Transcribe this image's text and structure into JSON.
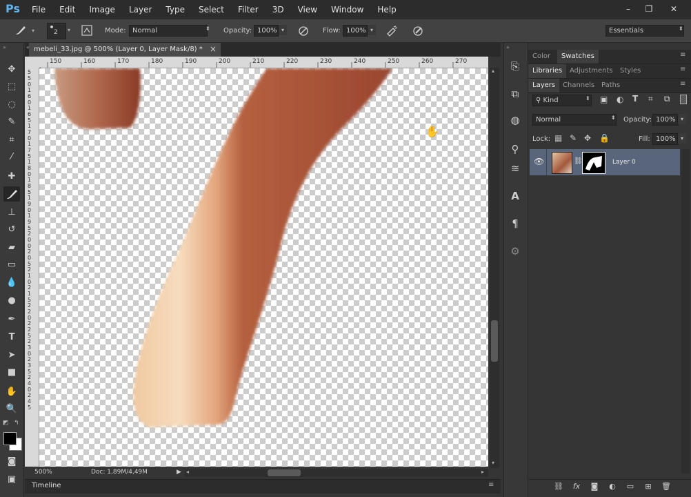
{
  "app": {
    "logo": "Ps",
    "menu": [
      "File",
      "Edit",
      "Image",
      "Layer",
      "Type",
      "Select",
      "Filter",
      "3D",
      "View",
      "Window",
      "Help"
    ],
    "window_controls": [
      "–",
      "❐",
      "✕"
    ]
  },
  "options_bar": {
    "brush_size": "2",
    "mode_label": "Mode:",
    "mode_value": "Normal",
    "opacity_label": "Opacity:",
    "opacity_value": "100%",
    "flow_label": "Flow:",
    "flow_value": "100%",
    "workspace": "Essentials"
  },
  "document": {
    "tab_title": "mebeli_33.jpg @ 500% (Layer 0, Layer Mask/8) *",
    "close": "×",
    "ruler_top": [
      "150",
      "160",
      "170",
      "180",
      "190",
      "200",
      "210",
      "220",
      "230",
      "240",
      "250",
      "260",
      "270"
    ],
    "ruler_left": [
      "5",
      "5",
      "0",
      "1",
      "6",
      "0",
      "1",
      "6",
      "5",
      "1",
      "7",
      "0",
      "1",
      "7",
      "5",
      "1",
      "8",
      "0",
      "1",
      "8",
      "5",
      "1",
      "9",
      "0",
      "1",
      "9",
      "5",
      "2",
      "0",
      "0",
      "2",
      "0",
      "5",
      "2",
      "1",
      "0",
      "2",
      "1",
      "5",
      "2",
      "2",
      "0",
      "2",
      "2",
      "5",
      "2",
      "3",
      "0",
      "2",
      "3",
      "5",
      "2",
      "4",
      "0",
      "2",
      "4",
      "5"
    ],
    "zoom": "500%",
    "doc_size": "Doc: 1,89M/4,49M",
    "status_arrow": "▶"
  },
  "timeline": {
    "label": "Timeline"
  },
  "panels": {
    "row1_tabs": [
      "Color",
      "Swatches"
    ],
    "row2_tabs": [
      "Libraries",
      "Adjustments",
      "Styles"
    ],
    "row3_tabs": [
      "Layers",
      "Channels",
      "Paths"
    ],
    "filter_kind": "Kind",
    "blend_mode": "Normal",
    "opacity_label": "Opacity:",
    "opacity_value": "100%",
    "lock_label": "Lock:",
    "fill_label": "Fill:",
    "fill_value": "100%",
    "layer_name": "Layer 0"
  },
  "colors": {
    "accent_blue": "#5fb4ef",
    "wood_dark": "#9a4630",
    "wood_light": "#f2cfa8",
    "selected_layer": "#59657a"
  }
}
